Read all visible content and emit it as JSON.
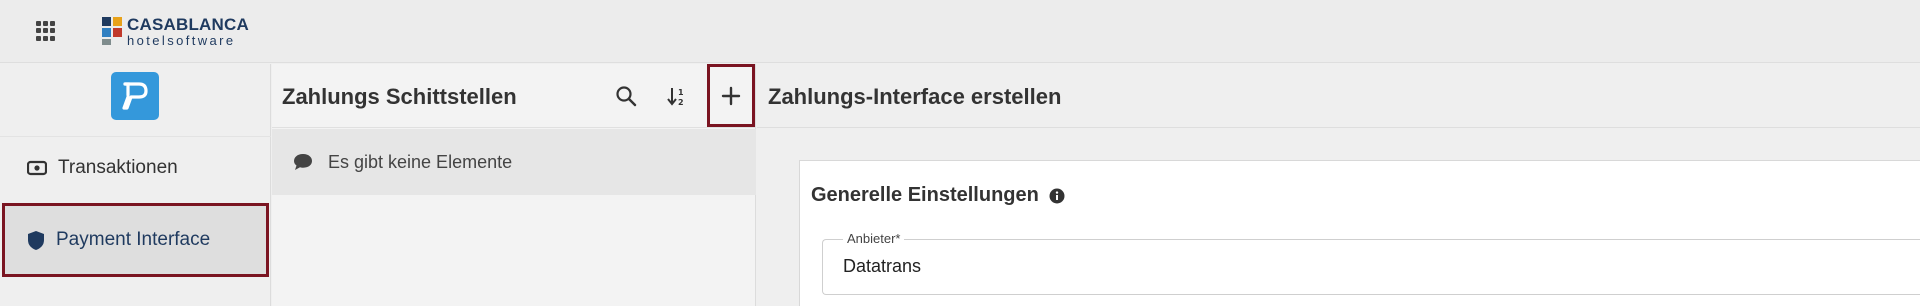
{
  "topbar": {
    "logo": {
      "brand": "CASABLANCA",
      "sub": "hotelsoftware"
    }
  },
  "leftnav": {
    "app_badge_icon": "payment-p-icon",
    "items": [
      {
        "label": "Transaktionen",
        "icon": "money-icon",
        "active": false
      },
      {
        "label": "Payment Interface",
        "icon": "shield-icon",
        "active": true
      }
    ]
  },
  "list_panel": {
    "title": "Zahlungs Schittstellen",
    "empty_text": "Es gibt keine Elemente"
  },
  "main": {
    "title": "Zahlungs-Interface erstellen",
    "section_title": "Generelle Einstellungen",
    "field": {
      "label": "Anbieter*",
      "value": "Datatrans"
    }
  },
  "colors": {
    "accent_blue": "#3498db",
    "highlight_border": "#7a1421",
    "brand_navy": "#1f3a5f"
  }
}
